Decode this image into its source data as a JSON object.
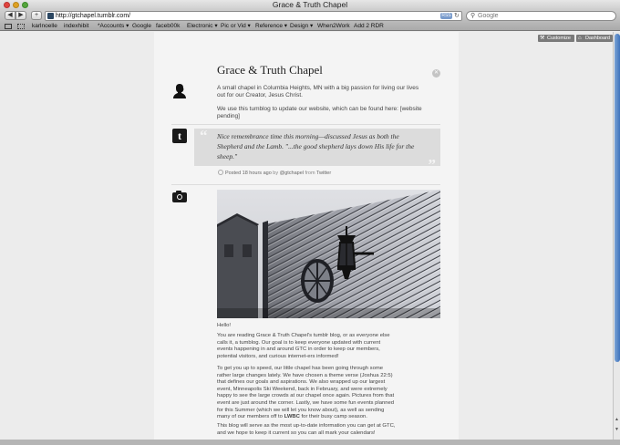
{
  "window": {
    "title": "Grace & Truth Chapel"
  },
  "toolbar": {
    "back": "◀",
    "forward": "▶",
    "add": "+",
    "url": "http://gtchapel.tumblr.com/",
    "rss": "RSS",
    "reload": "↻",
    "search_placeholder": "Google"
  },
  "bookmarks": [
    "karlnoelle",
    "indexhibit",
    "*Accounts ▾",
    "Google",
    "faceb00k",
    "Electronic ▾",
    "Pic or Vid ▾",
    "Reference ▾",
    "Design ▾",
    "When2Work",
    "Add 2 RDR"
  ],
  "controls": {
    "customize": "Customize",
    "dashboard": "Dashboard"
  },
  "blog": {
    "title": "Grace & Truth Chapel",
    "description_1": "A small chapel in Columbia Heights, MN with a big passion for living our lives out for our Creator, Jesus Christ.",
    "description_2": "We use this tumblog to update our website, which can be found here: [website pending]"
  },
  "tweet": {
    "text": "Nice remembrance time this morning—discussed Jesus as both the Shepherd and the Lamb. \"...the good shepherd lays down His life for the sheep.\"",
    "meta_posted": "Posted 18 hours ago",
    "meta_by": " by ",
    "meta_user": "@gtchapel",
    "meta_from": " from ",
    "meta_source": "Twitter"
  },
  "post": {
    "greeting": "Hello!",
    "para_1": "You are reading Grace & Truth Chapel's tumblr blog, or as everyone else calls it, a tumblog. Our goal is to keep everyone updated with current events happening in and around GTC in order to keep our members, potential visitors, and curious internet-ers informed!",
    "para_2_before": "To get you up to speed, our little chapel has been going through some rather large changes lately. We have chosen a theme verse (Joshua 22:5) that defines our goals and aspirations. We also wrapped up our largest event, Minneapolis Ski Weekend, back in February, and were extremely happy to see the large crowds at our chapel once again. Pictures from that event are just around the corner. Lastly, we have some fun events planned for this Summer (which we will let you know about), as well as sending many of our members off to ",
    "para_2_bold": "LWBC",
    "para_2_after": " for their busy camp season.",
    "para_3": "This blog will serve as the most up-to-date information you can get at GTC, and we hope to keep it current so you can all mark your calendars!"
  }
}
